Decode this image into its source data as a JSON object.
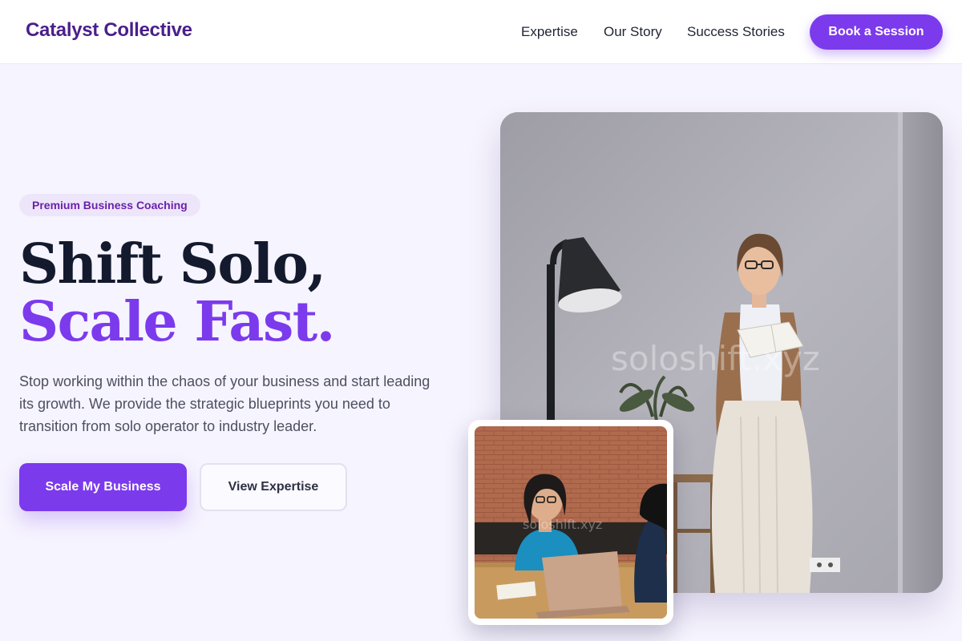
{
  "nav": {
    "brand": "Catalyst Collective",
    "links": [
      "Expertise",
      "Our Story",
      "Success Stories"
    ],
    "cta": "Book a Session"
  },
  "hero": {
    "badge": "Premium Business Coaching",
    "headline_line1": "Shift Solo,",
    "headline_line2": "Scale Fast.",
    "description": "Stop working within the chaos of your business and start leading its growth. We provide the strategic blueprints you need to transition from solo operator to industry leader.",
    "primary_button": "Scale My Business",
    "secondary_button": "View Expertise"
  },
  "images": {
    "main_watermark": "soloshift.xyz",
    "inset_watermark": "soloshift.xyz"
  },
  "colors": {
    "accent": "#7c3aed",
    "brand_text": "#4a1f8c",
    "headline_dark": "#141a2e",
    "page_bg": "#f6f4fe"
  }
}
